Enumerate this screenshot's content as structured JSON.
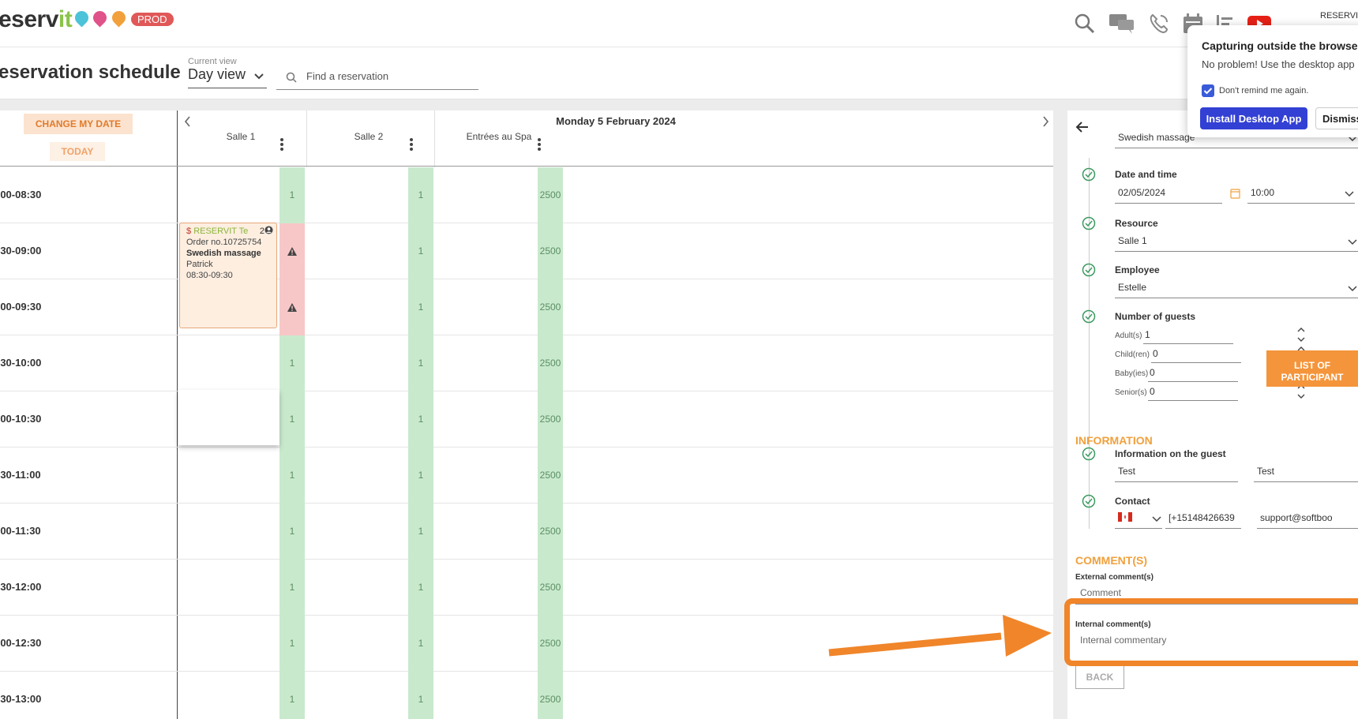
{
  "app": {
    "logo_text": "eserv",
    "logo_accent": "it",
    "env_badge": "PROD",
    "user_label": "RESERVIT"
  },
  "colors": {
    "accent_orange": "#f0852a",
    "capacity_green": "#c9e9cd",
    "warning_red": "#f7c7c7",
    "install_button": "#3340d4",
    "env_badge": "#e05858"
  },
  "top_icons": [
    "search-icon",
    "chat-icon",
    "phone-icon",
    "calendar-icon",
    "list-icon",
    "youtube-icon"
  ],
  "header": {
    "page_title": "eservation schedule",
    "view_label": "Current view",
    "view_value": "Day view",
    "search_placeholder": "Find a reservation"
  },
  "schedule": {
    "change_date_label": "CHANGE MY DATE",
    "today_label": "TODAY",
    "date_title": "Monday 5 February 2024",
    "resources": [
      {
        "name": "Salle 1"
      },
      {
        "name": "Salle 2"
      },
      {
        "name": "Entrées au Spa"
      }
    ],
    "rows": [
      {
        "time": ":00-08:30",
        "caps": [
          "1",
          "1",
          "2500"
        ]
      },
      {
        "time": ":30-09:00",
        "caps": [
          "",
          "1",
          "2500"
        ]
      },
      {
        "time": ":00-09:30",
        "caps": [
          "",
          "1",
          "2500"
        ]
      },
      {
        "time": ":30-10:00",
        "caps": [
          "1",
          "1",
          "2500"
        ]
      },
      {
        "time": ":00-10:30",
        "caps": [
          "1",
          "1",
          "2500"
        ]
      },
      {
        "time": ":30-11:00",
        "caps": [
          "1",
          "1",
          "2500"
        ]
      },
      {
        "time": ":00-11:30",
        "caps": [
          "1",
          "1",
          "2500"
        ]
      },
      {
        "time": ":30-12:00",
        "caps": [
          "1",
          "1",
          "2500"
        ]
      },
      {
        "time": ":00-12:30",
        "caps": [
          "1",
          "1",
          "2500"
        ]
      },
      {
        "time": ":30-13:00",
        "caps": [
          "1",
          "1",
          "2500"
        ]
      }
    ],
    "booking": {
      "dollar": "$",
      "client": "RESERVIT Te",
      "count": "2",
      "order": "Order no.10725754",
      "service": "Swedish massage",
      "employee": "Patrick",
      "time": "08:30-09:30"
    }
  },
  "form": {
    "service_value": "Swedish massage",
    "date_time_label": "Date and time",
    "date_value": "02/05/2024",
    "time_value": "10:00",
    "resource_label": "Resource",
    "resource_value": "Salle 1",
    "employee_label": "Employee",
    "employee_value": "Estelle",
    "guests_label": "Number of guests",
    "guests": [
      {
        "label": "Adult(s)",
        "value": "1"
      },
      {
        "label": "Child(ren)",
        "value": "0"
      },
      {
        "label": "Baby(ies)",
        "value": "0"
      },
      {
        "label": "Senior(s)",
        "value": "0"
      }
    ],
    "list_participants_label": "LIST OF PARTICIPANT",
    "information_title": "INFORMATION",
    "guest_info_label": "Information on the guest",
    "first_name": "Test",
    "last_name": "Test",
    "contact_label": "Contact",
    "phone": "[+15148426639",
    "email": "support@softboo",
    "comments_title": "COMMENT(S)",
    "external_comment_label": "External comment(s)",
    "external_comment_placeholder": "Comment",
    "internal_comment_label": "Internal comment(s)",
    "internal_comment_placeholder": "Internal commentary",
    "back_label": "BACK"
  },
  "popup": {
    "title": "Capturing outside the browser?",
    "text": "No problem! Use the desktop app",
    "checkbox_label": "Don't remind me again.",
    "checkbox_checked": true,
    "install_label": "Install Desktop App",
    "dismiss_label": "Dismiss"
  }
}
